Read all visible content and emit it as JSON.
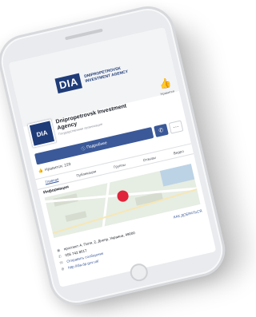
{
  "cover": {
    "logo_mark": "DIA",
    "logo_text": "DNIPROPETROVSK INVESTMENT AGENCY"
  },
  "like_button": {
    "label": "Нравится"
  },
  "profile": {
    "avatar_text": "DIA",
    "name": "Dnipropetrovsk Investment Agency",
    "category": "Государственная организация"
  },
  "actions": {
    "primary_label": "Подробнее"
  },
  "likes": {
    "text": "Нравится: 229"
  },
  "tabs": [
    {
      "label": "Главная"
    },
    {
      "label": "Публикации"
    },
    {
      "label": "Группы"
    },
    {
      "label": "Отзывы"
    },
    {
      "label": "Видео"
    }
  ],
  "info": {
    "title": "Информация",
    "directions_link": "КАК ДОБРАТЬСЯ",
    "address": "проспект А. Поля, 2, Днепр, Украина, 49000",
    "phone": "056 742 8617",
    "message": "Отправить сообщение",
    "website": "http://dia.dp.gov.ua/"
  }
}
